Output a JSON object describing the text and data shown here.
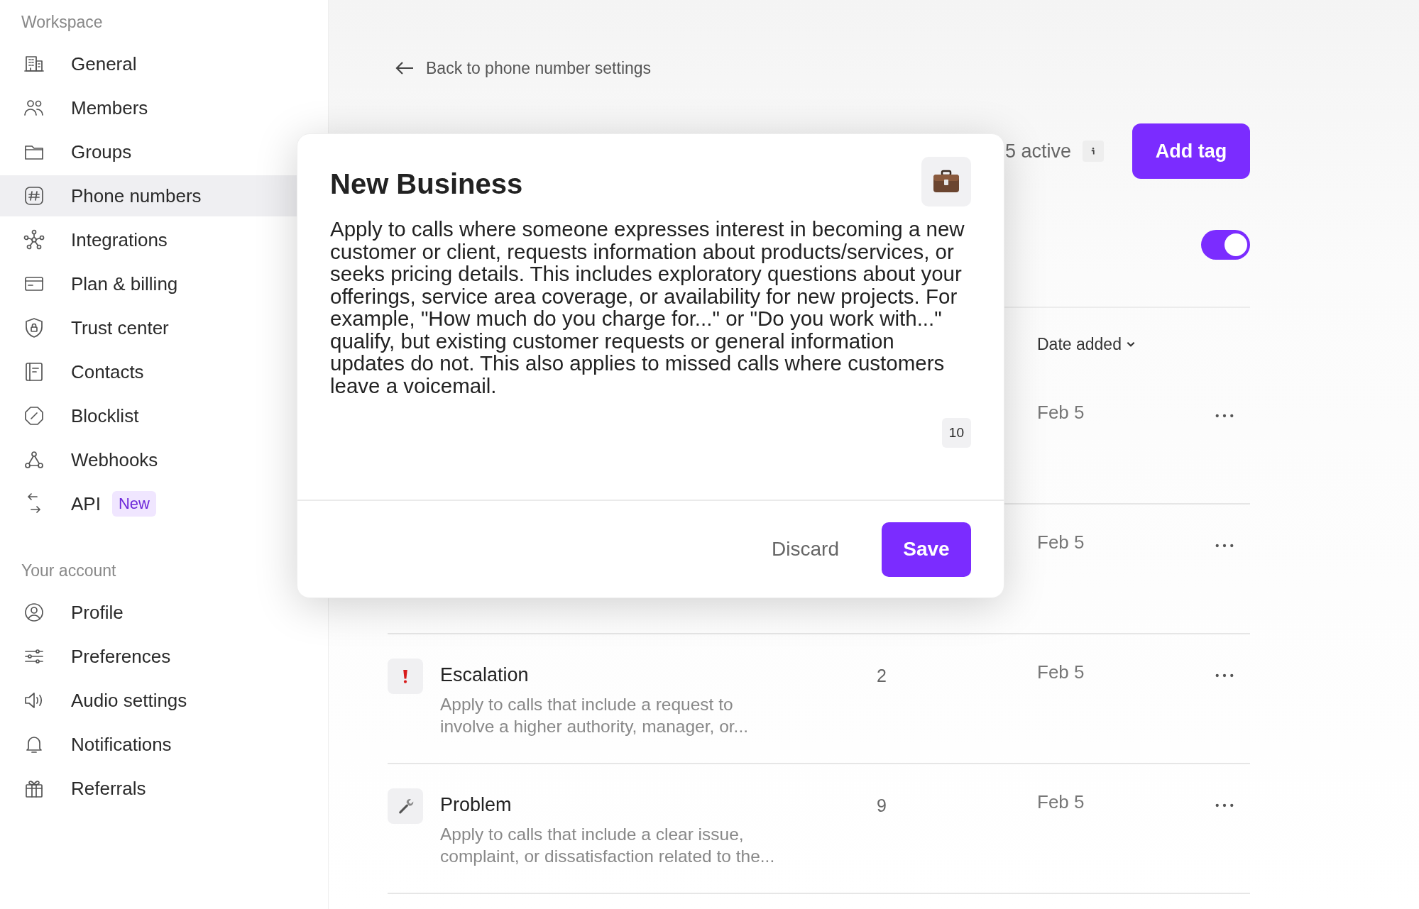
{
  "sidebar": {
    "sections": [
      {
        "title": "Workspace",
        "items": [
          {
            "label": "General",
            "selected": false
          },
          {
            "label": "Members",
            "selected": false
          },
          {
            "label": "Groups",
            "selected": false
          },
          {
            "label": "Phone numbers",
            "selected": true
          },
          {
            "label": "Integrations",
            "selected": false
          },
          {
            "label": "Plan & billing",
            "selected": false
          },
          {
            "label": "Trust center",
            "selected": false
          },
          {
            "label": "Contacts",
            "selected": false
          },
          {
            "label": "Blocklist",
            "selected": false
          },
          {
            "label": "Webhooks",
            "selected": false
          },
          {
            "label": "API",
            "selected": false,
            "badge": "New"
          }
        ]
      },
      {
        "title": "Your account",
        "items": [
          {
            "label": "Profile",
            "selected": false
          },
          {
            "label": "Preferences",
            "selected": false
          },
          {
            "label": "Audio settings",
            "selected": false
          },
          {
            "label": "Notifications",
            "selected": false
          },
          {
            "label": "Referrals",
            "selected": false
          }
        ]
      }
    ]
  },
  "back_link": "Back to phone number settings",
  "active_count": "5 active",
  "add_button": "Add tag",
  "toggle": {
    "on": true
  },
  "table": {
    "sort_column": "Date added",
    "rows": [
      {
        "date": "Feb 5"
      },
      {
        "date": "Feb 5"
      },
      {
        "kind": "alert",
        "name": "Escalation",
        "description": "Apply to calls that include a request to involve a higher authority, manager, or...",
        "count": "2",
        "date": "Feb 5"
      },
      {
        "kind": "tool",
        "name": "Problem",
        "description": "Apply to calls that include a clear issue, complaint, or dissatisfaction related to the...",
        "count": "9",
        "date": "Feb 5"
      }
    ]
  },
  "dialog": {
    "title": "New Business",
    "description": "Apply to calls where someone expresses interest in becoming a new customer or client, requests information about products/services, or seeks pricing details. This includes exploratory questions about your offerings, service area coverage, or availability for new projects. For example, \"How much do you charge for...\" or \"Do you work with...\" qualify, but existing customer requests or general information updates do not. This also applies to missed calls where customers leave a voicemail.",
    "count": "10",
    "buttons": [
      {
        "label": "Discard",
        "kind": "secondary"
      },
      {
        "label": "Save",
        "kind": "primary"
      }
    ]
  }
}
